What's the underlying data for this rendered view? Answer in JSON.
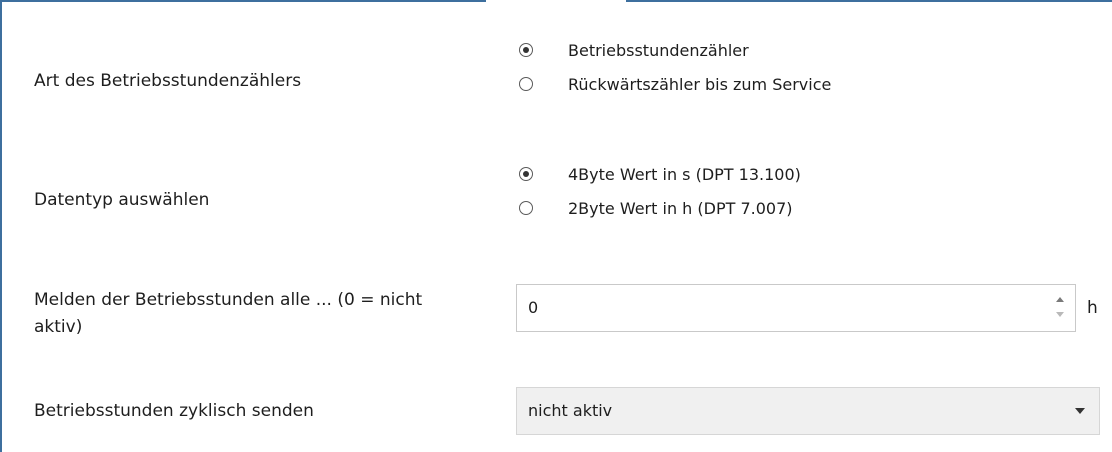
{
  "fields": {
    "art": {
      "label": "Art des Betriebsstundenzählers",
      "options": [
        {
          "label": "Betriebsstundenzähler",
          "selected": true
        },
        {
          "label": "Rückwärtszähler bis zum Service",
          "selected": false
        }
      ]
    },
    "datentyp": {
      "label": "Datentyp auswählen",
      "options": [
        {
          "label": "4Byte Wert in s (DPT 13.100)",
          "selected": true
        },
        {
          "label": "2Byte Wert in h (DPT 7.007)",
          "selected": false
        }
      ]
    },
    "melden": {
      "label_line1": "Melden der Betriebsstunden alle ...  (0 = nicht",
      "label_line2": "aktiv)",
      "value": "0",
      "unit": "h"
    },
    "zyklisch": {
      "label": "Betriebsstunden zyklisch senden",
      "selected": "nicht aktiv"
    }
  },
  "colors": {
    "frame_border": "#3d6f9e",
    "select_background": "#f0f0f0"
  }
}
